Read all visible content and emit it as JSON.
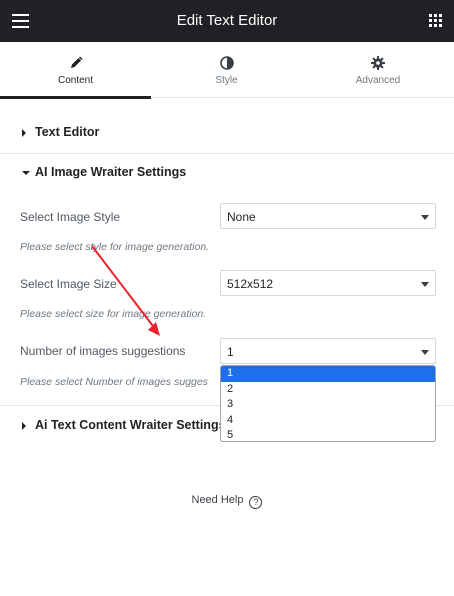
{
  "header": {
    "title": "Edit Text Editor",
    "menu_icon": "hamburger-icon",
    "apps_icon": "grid-icon"
  },
  "tabs": [
    {
      "label": "Content",
      "icon": "pencil-icon",
      "active": true
    },
    {
      "label": "Style",
      "icon": "half-circle-icon",
      "active": false
    },
    {
      "label": "Advanced",
      "icon": "gear-icon",
      "active": false
    }
  ],
  "sections": {
    "text_editor": {
      "title": "Text Editor",
      "expanded": false
    },
    "ai_image": {
      "title": "AI Image Wraiter Settings",
      "expanded": true,
      "style": {
        "label": "Select Image Style",
        "value": "None",
        "hint": "Please select style for image generation."
      },
      "size": {
        "label": "Select Image Size",
        "value": "512x512",
        "hint": "Please select size for image generation."
      },
      "count": {
        "label": "Number of images suggestions",
        "value": "1",
        "hint": "Please select Number of images sugges"
      },
      "count_options": [
        "1",
        "2",
        "3",
        "4",
        "5"
      ]
    },
    "ai_text": {
      "title": "Ai Text Content Wraiter Settings",
      "expanded": false
    }
  },
  "help": {
    "label": "Need Help",
    "icon": "question-circle-icon"
  },
  "colors": {
    "header_bg": "#1f2124",
    "selected_option": "#1e6fe8",
    "annotation_arrow": "#e8232a"
  }
}
